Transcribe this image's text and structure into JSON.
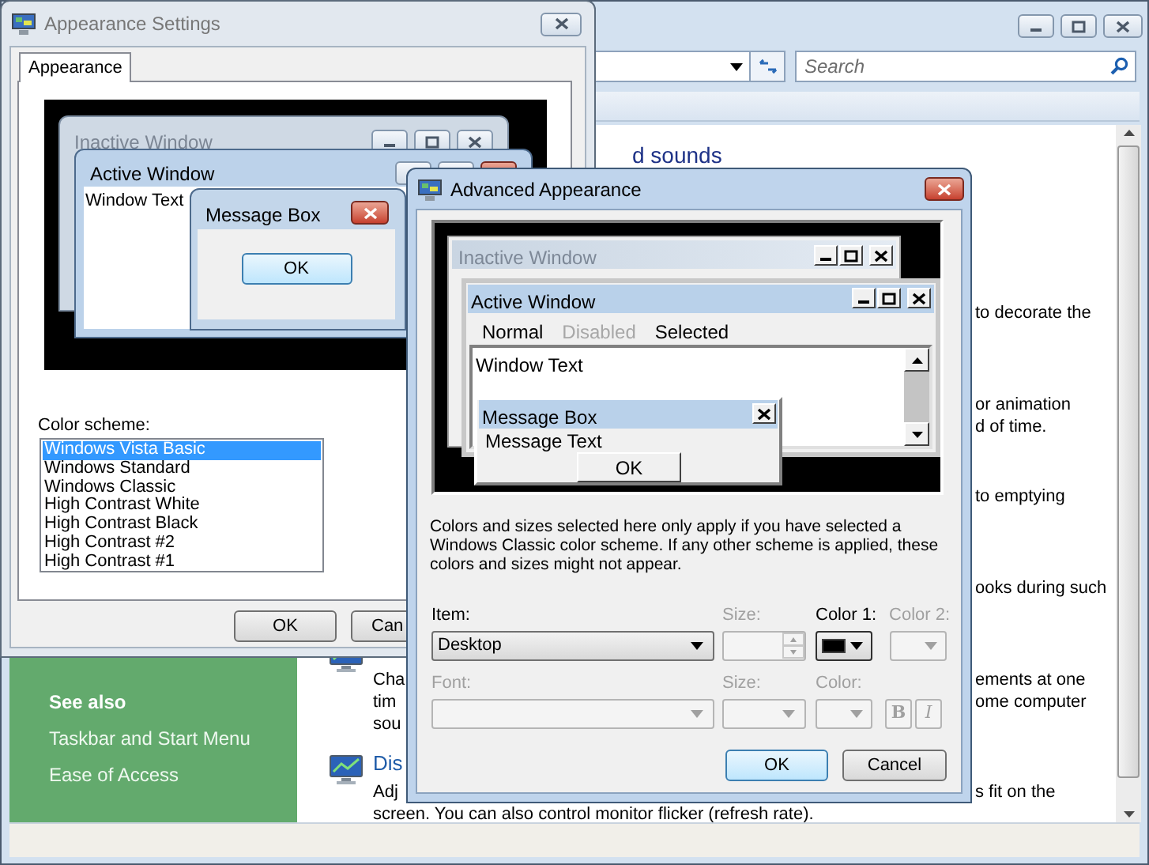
{
  "control_panel": {
    "search": {
      "placeholder": "Search"
    },
    "heading": "d sounds",
    "tasks": [
      {
        "lines": [
          {
            "right": "to decorate the"
          }
        ]
      },
      {
        "lines": [
          {
            "right": "or animation"
          },
          {
            "right": "d of time."
          }
        ]
      },
      {
        "lines": [
          {
            "right": "to emptying"
          }
        ]
      },
      {
        "lines": [
          {
            "right": "ooks during such"
          }
        ]
      },
      {
        "icon": true,
        "lines": [
          {
            "left": "Cha",
            "right": "ements at one"
          },
          {
            "left": "tim",
            "right": "ome computer"
          },
          {
            "left": "sou"
          }
        ]
      },
      {
        "icon": true,
        "title": "Dis",
        "lines": [
          {
            "left": "Adj",
            "right": "s fit on the"
          },
          {
            "left": "screen. You can also control monitor flicker (refresh rate)."
          }
        ]
      }
    ],
    "see_also": {
      "heading": "See also",
      "links": [
        "Taskbar and Start Menu",
        "Ease of Access"
      ]
    }
  },
  "appearance_settings": {
    "title": "Appearance Settings",
    "tabs": [
      {
        "label": "Appearance",
        "selected": true
      }
    ],
    "preview": {
      "inactive_title": "Inactive Window",
      "active_title": "Active Window",
      "window_text": "Window Text",
      "message_box": {
        "title": "Message Box",
        "button": "OK"
      }
    },
    "color_scheme": {
      "label": "Color scheme:",
      "options": [
        {
          "label": "Windows Vista Basic",
          "selected": true
        },
        {
          "label": "Windows Standard",
          "selected": false
        },
        {
          "label": "Windows Classic",
          "selected": false
        },
        {
          "label": "High Contrast White",
          "selected": false
        },
        {
          "label": "High Contrast Black",
          "selected": false
        },
        {
          "label": "High Contrast #2",
          "selected": false
        },
        {
          "label": "High Contrast #1",
          "selected": false
        }
      ]
    },
    "buttons": [
      {
        "label": "OK"
      },
      {
        "label": "Can"
      }
    ]
  },
  "advanced_appearance": {
    "title": "Advanced Appearance",
    "preview": {
      "inactive_title": "Inactive Window",
      "active_title": "Active Window",
      "menu": [
        {
          "label": "Normal",
          "disabled": false
        },
        {
          "label": "Disabled",
          "disabled": true
        },
        {
          "label": "Selected",
          "disabled": false
        }
      ],
      "window_text": "Window Text",
      "message_box": {
        "title": "Message Box",
        "text": "Message Text",
        "button": "OK"
      }
    },
    "note": "Colors and sizes selected here only apply if you have selected a Windows Classic color scheme. If any other scheme is applied, these colors and sizes might not appear.",
    "rows": [
      [
        {
          "kind": "wide_select",
          "label": "Item:",
          "value": "Desktop",
          "disabled": false
        },
        {
          "kind": "spin",
          "label": "Size:",
          "disabled": true
        },
        {
          "kind": "color",
          "label": "Color 1:",
          "color": "#000000",
          "disabled": false
        },
        {
          "kind": "color",
          "label": "Color 2:",
          "disabled": true
        }
      ],
      [
        {
          "kind": "wide_select",
          "label": "Font:",
          "disabled": true
        },
        {
          "kind": "narrow_select",
          "label": "Size:",
          "disabled": true
        },
        {
          "kind": "color",
          "label": "Color:",
          "disabled": true
        },
        {
          "kind": "bold_toggle",
          "text": "B",
          "disabled": true
        },
        {
          "kind": "italic_toggle",
          "text": "I",
          "disabled": true
        }
      ]
    ],
    "buttons": [
      {
        "label": "OK",
        "default": true
      },
      {
        "label": "Cancel",
        "default": false
      }
    ]
  }
}
